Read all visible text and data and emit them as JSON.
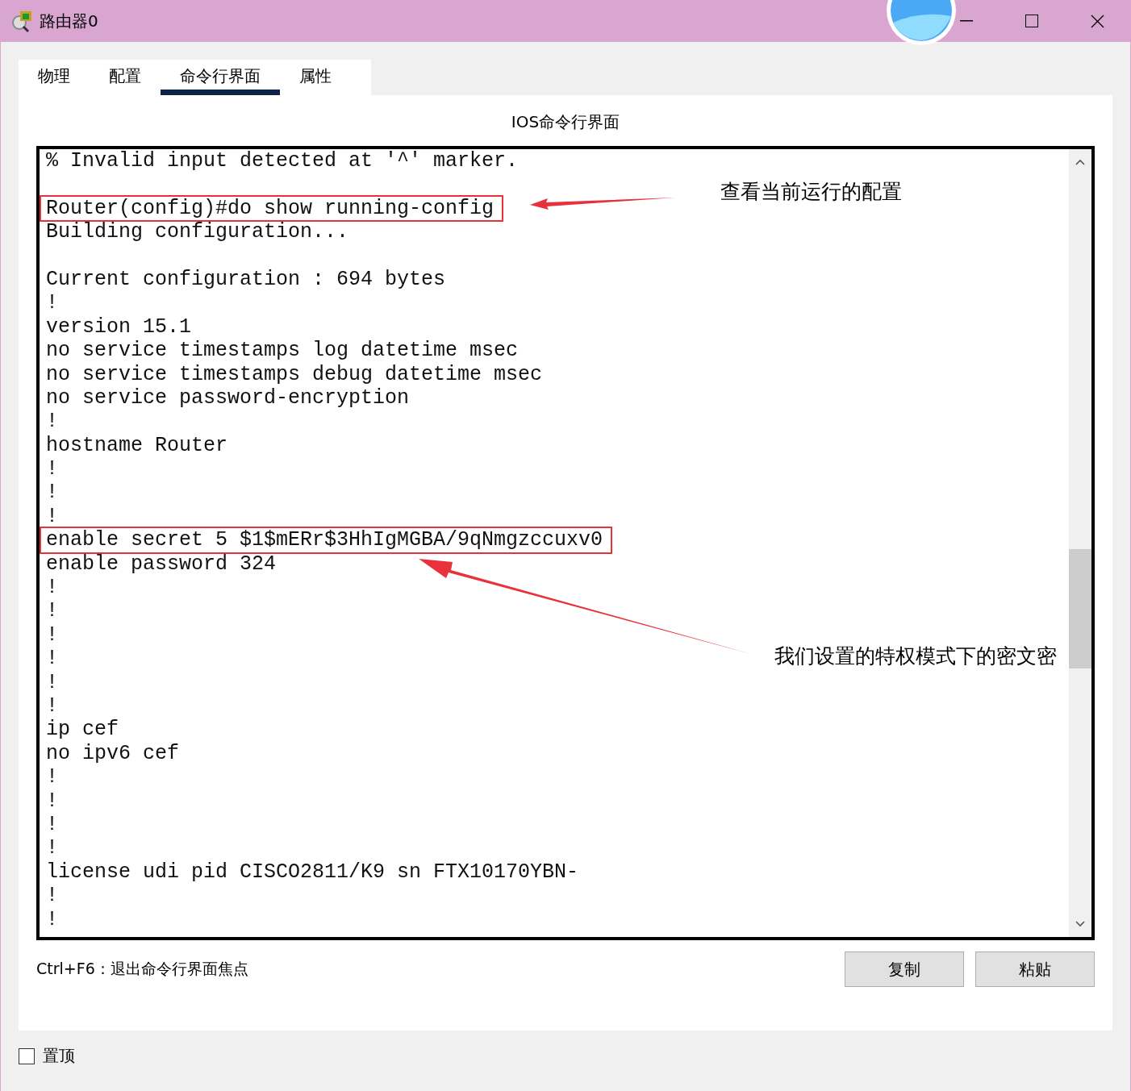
{
  "window": {
    "title": "路由器0"
  },
  "tabs": [
    {
      "label": "物理",
      "selected": false
    },
    {
      "label": "配置",
      "selected": false
    },
    {
      "label": "命令行界面",
      "selected": true
    },
    {
      "label": "属性",
      "selected": false
    }
  ],
  "panel_title": "IOS命令行界面",
  "terminal": {
    "lines": [
      {
        "text": "% Invalid input detected at '^' marker."
      },
      {
        "kind": "blank"
      },
      {
        "text": "Router(config)#do show running-config",
        "boxed": true
      },
      {
        "text": "Building configuration..."
      },
      {
        "kind": "blank"
      },
      {
        "text": "Current configuration : 694 bytes"
      },
      {
        "text": "!"
      },
      {
        "text": "version 15.1"
      },
      {
        "text": "no service timestamps log datetime msec"
      },
      {
        "text": "no service timestamps debug datetime msec"
      },
      {
        "text": "no service password-encryption"
      },
      {
        "text": "!"
      },
      {
        "text": "hostname Router"
      },
      {
        "text": "!"
      },
      {
        "text": "!"
      },
      {
        "text": "!"
      },
      {
        "text": "enable secret 5 $1$mERr$3HhIgMGBA/9qNmgzccuxv0",
        "boxed": true
      },
      {
        "text": "enable password 324"
      },
      {
        "text": "!"
      },
      {
        "text": "!"
      },
      {
        "text": "!"
      },
      {
        "text": "!"
      },
      {
        "text": "!"
      },
      {
        "text": "!"
      },
      {
        "text": "ip cef"
      },
      {
        "text": "no ipv6 cef"
      },
      {
        "text": "!"
      },
      {
        "text": "!"
      },
      {
        "text": "!"
      },
      {
        "text": "!"
      },
      {
        "text": "license udi pid CISCO2811/K9 sn FTX10170YBN-"
      },
      {
        "text": "!"
      },
      {
        "text": "!"
      }
    ]
  },
  "annotations": [
    {
      "text": "查看当前运行的配置"
    },
    {
      "text": "我们设置的特权模式下的密文密"
    }
  ],
  "hint": "Ctrl+F6：退出命令行界面焦点",
  "buttons": [
    "复制",
    "粘贴"
  ],
  "pin_checkbox": {
    "label": "置顶",
    "checked": false
  }
}
